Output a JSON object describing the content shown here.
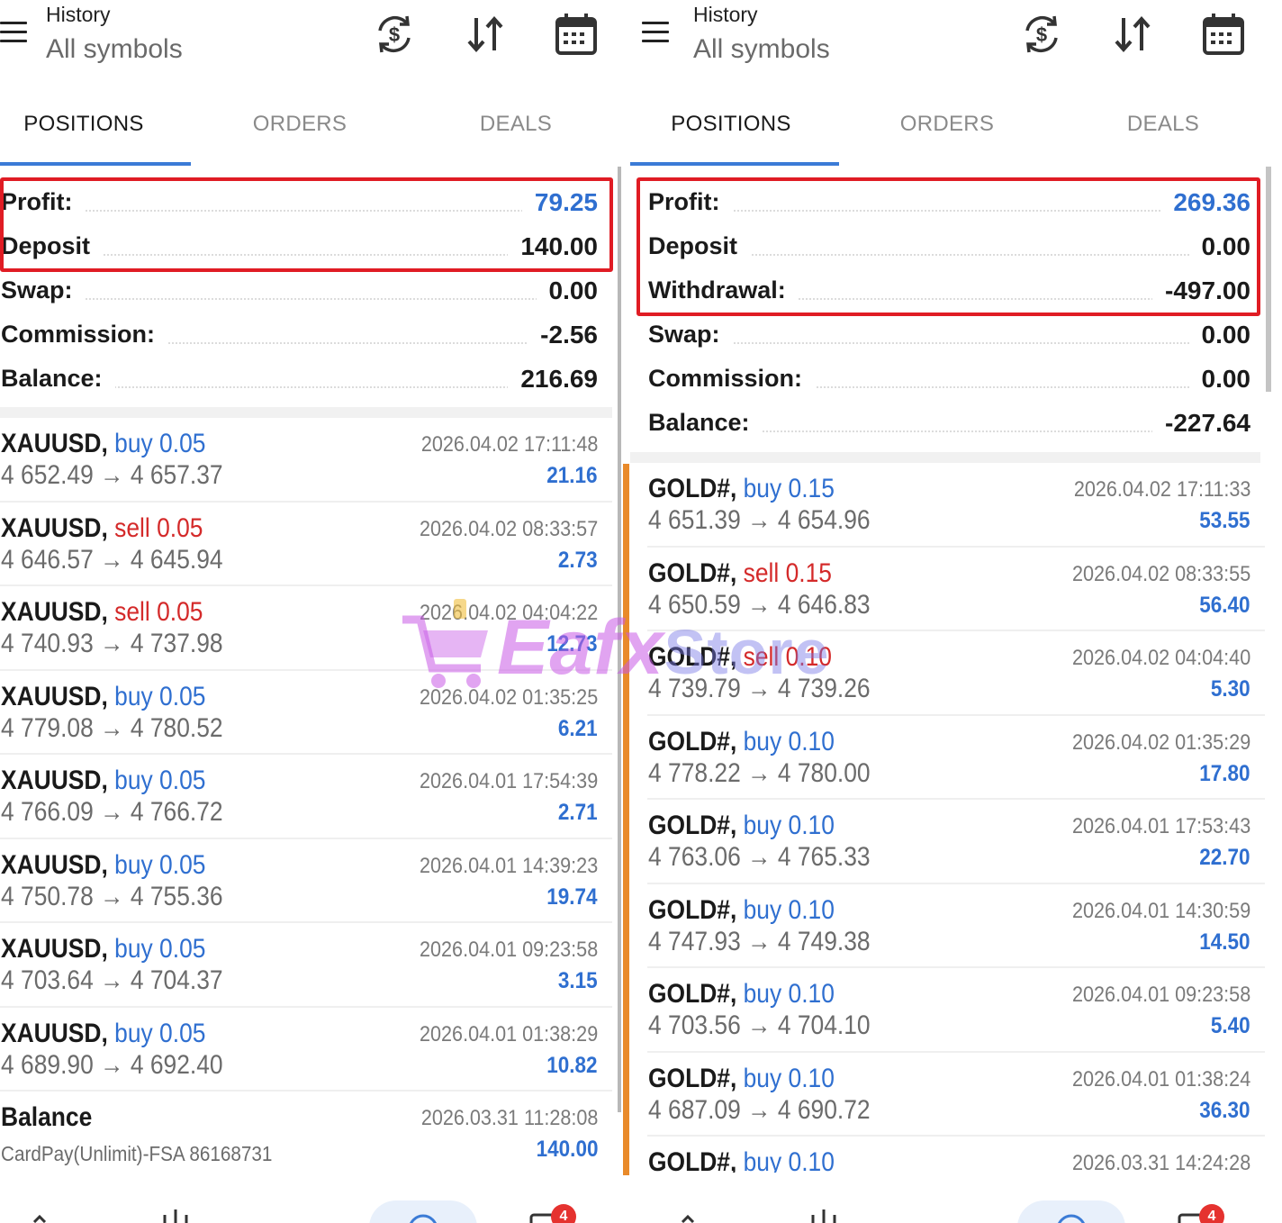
{
  "colors": {
    "accent": "#3b7bd6",
    "buy": "#2f6fd0",
    "sell": "#d42a2a",
    "highlight": "#e01c24",
    "orange_bar": "#e98a2a"
  },
  "left": {
    "header": {
      "title": "History",
      "subtitle": "All symbols"
    },
    "tabs": [
      "POSITIONS",
      "ORDERS",
      "DEALS"
    ],
    "summary": [
      {
        "label": "Profit:",
        "value": "79.25"
      },
      {
        "label": "Deposit",
        "value": "140.00"
      },
      {
        "label": "Swap:",
        "value": "0.00"
      },
      {
        "label": "Commission:",
        "value": "-2.56"
      },
      {
        "label": "Balance:",
        "value": "216.69"
      }
    ],
    "trades": [
      {
        "symbol": "XAUUSD,",
        "direction": "buy 0.05",
        "prices": "4 652.49 → 4 657.37",
        "time": "2026.04.02 17:11:48",
        "profit": "21.16"
      },
      {
        "symbol": "XAUUSD,",
        "direction": "sell 0.05",
        "prices": "4 646.57 → 4 645.94",
        "time": "2026.04.02 08:33:57",
        "profit": "2.73"
      },
      {
        "symbol": "XAUUSD,",
        "direction": "sell 0.05",
        "prices": "4 740.93 → 4 737.98",
        "time": "2026.04.02 04:04:22",
        "profit": "12.73"
      },
      {
        "symbol": "XAUUSD,",
        "direction": "buy 0.05",
        "prices": "4 779.08 → 4 780.52",
        "time": "2026.04.02 01:35:25",
        "profit": "6.21"
      },
      {
        "symbol": "XAUUSD,",
        "direction": "buy 0.05",
        "prices": "4 766.09 → 4 766.72",
        "time": "2026.04.01 17:54:39",
        "profit": "2.71"
      },
      {
        "symbol": "XAUUSD,",
        "direction": "buy 0.05",
        "prices": "4 750.78 → 4 755.36",
        "time": "2026.04.01 14:39:23",
        "profit": "19.74"
      },
      {
        "symbol": "XAUUSD,",
        "direction": "buy 0.05",
        "prices": "4 703.64 → 4 704.37",
        "time": "2026.04.01 09:23:58",
        "profit": "3.15"
      },
      {
        "symbol": "XAUUSD,",
        "direction": "buy 0.05",
        "prices": "4 689.90 → 4 692.40",
        "time": "2026.04.01 01:38:29",
        "profit": "10.82"
      }
    ],
    "balance_entry": {
      "label": "Balance",
      "note": "CardPay(Unlimit)-FSA 86168731",
      "time": "2026.03.31 11:28:08",
      "amount": "140.00"
    },
    "nav_badge": "4"
  },
  "right": {
    "header": {
      "title": "History",
      "subtitle": "All symbols"
    },
    "tabs": [
      "POSITIONS",
      "ORDERS",
      "DEALS"
    ],
    "summary": [
      {
        "label": "Profit:",
        "value": "269.36"
      },
      {
        "label": "Deposit",
        "value": "0.00"
      },
      {
        "label": "Withdrawal:",
        "value": "-497.00"
      },
      {
        "label": "Swap:",
        "value": "0.00"
      },
      {
        "label": "Commission:",
        "value": "0.00"
      },
      {
        "label": "Balance:",
        "value": "-227.64"
      }
    ],
    "trades": [
      {
        "symbol": "GOLD#,",
        "direction": "buy 0.15",
        "prices": "4 651.39 → 4 654.96",
        "time": "2026.04.02 17:11:33",
        "profit": "53.55"
      },
      {
        "symbol": "GOLD#,",
        "direction": "sell 0.15",
        "prices": "4 650.59 → 4 646.83",
        "time": "2026.04.02 08:33:55",
        "profit": "56.40"
      },
      {
        "symbol": "GOLD#,",
        "direction": "sell 0.10",
        "prices": "4 739.79 → 4 739.26",
        "time": "2026.04.02 04:04:40",
        "profit": "5.30"
      },
      {
        "symbol": "GOLD#,",
        "direction": "buy 0.10",
        "prices": "4 778.22 → 4 780.00",
        "time": "2026.04.02 01:35:29",
        "profit": "17.80"
      },
      {
        "symbol": "GOLD#,",
        "direction": "buy 0.10",
        "prices": "4 763.06 → 4 765.33",
        "time": "2026.04.01 17:53:43",
        "profit": "22.70"
      },
      {
        "symbol": "GOLD#,",
        "direction": "buy 0.10",
        "prices": "4 747.93 → 4 749.38",
        "time": "2026.04.01 14:30:59",
        "profit": "14.50"
      },
      {
        "symbol": "GOLD#,",
        "direction": "buy 0.10",
        "prices": "4 703.56 → 4 704.10",
        "time": "2026.04.01 09:23:58",
        "profit": "5.40"
      },
      {
        "symbol": "GOLD#,",
        "direction": "buy 0.10",
        "prices": "4 687.09 → 4 690.72",
        "time": "2026.04.01 01:38:24",
        "profit": "36.30"
      },
      {
        "symbol": "GOLD#,",
        "direction": "buy 0.10",
        "prices": "",
        "time": "2026.03.31 14:24:28",
        "profit": ""
      }
    ],
    "nav_badge": "4"
  },
  "watermark": {
    "main": "Eafx",
    "store": "Store"
  }
}
